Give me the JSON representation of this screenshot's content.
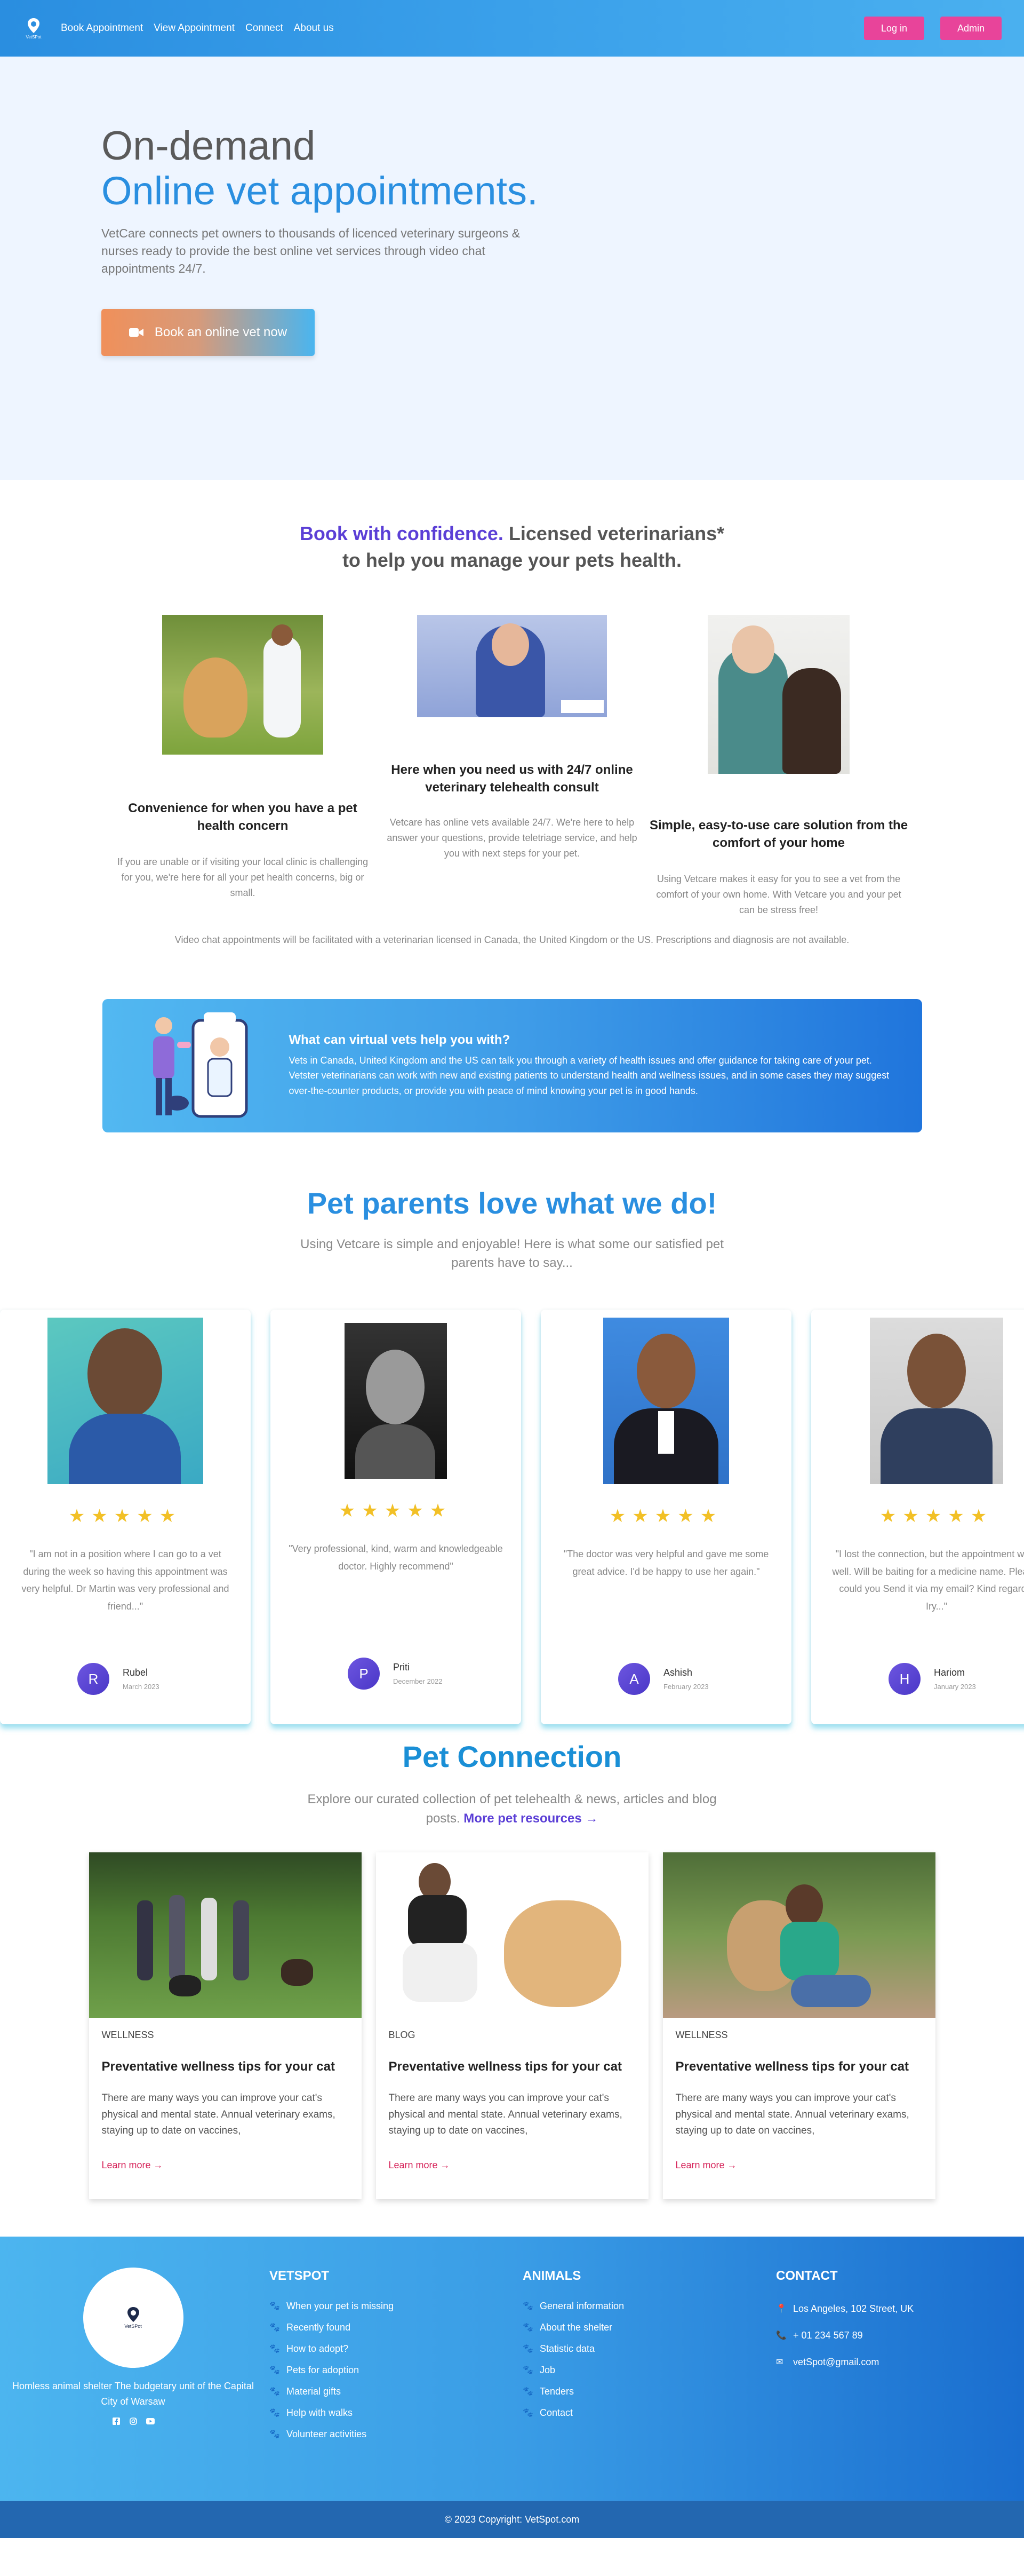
{
  "nav": {
    "logo_text": "VetSPot",
    "links": [
      "Book Appointment",
      "View Appointment",
      "Connect",
      "About us"
    ],
    "login": "Log in",
    "admin": "Admin"
  },
  "hero": {
    "line1": "On-demand",
    "line2": "Online vet appointments.",
    "description": "VetCare connects pet owners to thousands of licenced veterinary surgeons & nurses ready to provide the best online vet services through video chat appointments 24/7.",
    "cta": "Book an online vet now"
  },
  "confidence": {
    "title_accent": "Book with confidence.",
    "title_rest": " Licensed veterinarians* to help you manage your pets health.",
    "features": [
      {
        "title": "Convenience for when you have a pet health concern",
        "desc": "If you are unable or if visiting your local clinic is challenging for you, we're here for all your pet health concerns, big or small."
      },
      {
        "title": "Here when you need us with 24/7 online veterinary telehealth consult",
        "desc": "Vetcare has online vets available 24/7. We're here to help answer your questions, provide teletriage service, and help you with next steps for your pet."
      },
      {
        "title": "Simple, easy-to-use care solution from the comfort of your home",
        "desc": "Using Vetcare makes it easy for you to see a vet from the comfort of your own home. With Vetcare you and your pet can be stress free!"
      }
    ],
    "disclaimer": "Video chat appointments will be facilitated with a veterinarian licensed in Canada, the United Kingdom or the US. Prescriptions and diagnosis are not available."
  },
  "virtual": {
    "title": "What can virtual vets help you with?",
    "text": "Vets in Canada, United Kingdom and the US can talk you through a variety of health issues and offer guidance for taking care of your pet. Vetster veterinarians can work with new and existing patients to understand health and wellness issues, and in some cases they may suggest over-the-counter products, or provide you with peace of mind knowing your pet is in good hands."
  },
  "testimonials": {
    "title": "Pet parents love what we do!",
    "subtitle": "Using Vetcare is simple and enjoyable! Here is what some our satisfied pet parents have to say...",
    "rating": 5,
    "items": [
      {
        "quote": "\"I am not in a position where I can go to a vet during the week so having this appointment was very helpful. Dr Martin was very professional and friend...\"",
        "initial": "R",
        "name": "Rubel",
        "date": "March 2023"
      },
      {
        "quote": "\"Very professional, kind, warm and knowledgeable doctor. Highly recommend\"",
        "initial": "P",
        "name": "Priti",
        "date": "December 2022"
      },
      {
        "quote": "\"The doctor was very helpful and gave me some great advice. I'd be happy to use her again.\"",
        "initial": "A",
        "name": "Ashish",
        "date": "February 2023"
      },
      {
        "quote": "\"I lost the connection, but the appointment went well. Will be baiting for a medicine name. Please, could you Send it via my email? Kind regards, Iry...\"",
        "initial": "H",
        "name": "Hariom",
        "date": "January 2023"
      }
    ]
  },
  "petcon": {
    "title": "Pet Connection",
    "subtitle": "Explore our curated collection of pet telehealth & news, articles and blog posts.",
    "more_link": "More pet resources →",
    "posts": [
      {
        "category": "WELLNESS",
        "title": "Preventative wellness tips for your cat",
        "desc": "There are many ways you can improve your cat's physical and mental state. Annual veterinary exams, staying up to date on vaccines,",
        "link": "Learn more →"
      },
      {
        "category": "BLOG",
        "title": "Preventative wellness tips for your cat",
        "desc": "There are many ways you can improve your cat's physical and mental state. Annual veterinary exams, staying up to date on vaccines,",
        "link": "Learn more →"
      },
      {
        "category": "WELLNESS",
        "title": "Preventative wellness tips for your cat",
        "desc": "There are many ways you can improve your cat's physical and mental state. Annual veterinary exams, staying up to date on vaccines,",
        "link": "Learn more →"
      }
    ]
  },
  "footer": {
    "logo_text": "VetSPot",
    "about": "Homless animal shelter The budgetary unit of the Capital City of Warsaw",
    "vetspot_title": "VETSPOT",
    "vetspot_links": [
      "When your pet is missing",
      "Recently found",
      "How to adopt?",
      "Pets for adoption",
      "Material gifts",
      "Help with walks",
      "Volunteer activities"
    ],
    "animals_title": "ANIMALS",
    "animals_links": [
      "General information",
      "About the shelter",
      "Statistic data",
      "Job",
      "Tenders",
      "Contact"
    ],
    "contact_title": "CONTACT",
    "address": "Los Angeles, 102 Street, UK",
    "phone": "+ 01 234 567 89",
    "email": "vetSpot@gmail.com",
    "copyright": "© 2023 Copyright: VetSpot.com"
  },
  "colors": {
    "primary": "#2a8fe0",
    "accent_pink": "#e8449a",
    "purple": "#5b3fd6",
    "star": "#f2c026"
  }
}
